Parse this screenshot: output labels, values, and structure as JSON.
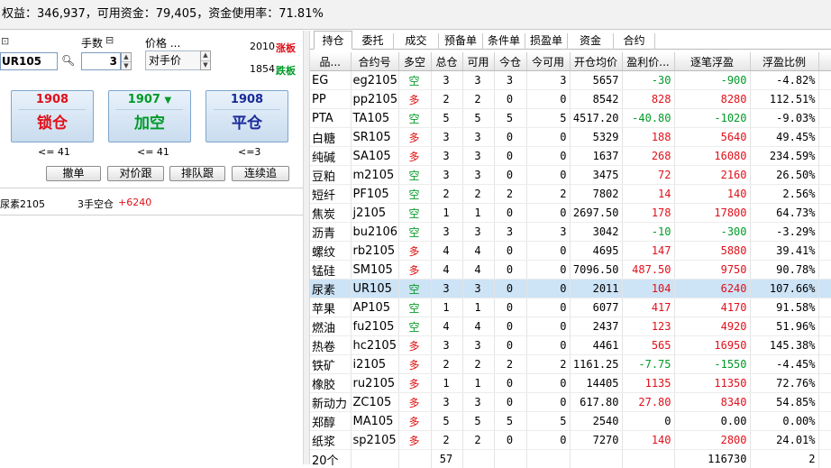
{
  "account": {
    "summary_text": "权益：346,937，可用资金：79,405，资金使用率：71.81%"
  },
  "order_panel": {
    "contract": "UR105",
    "qty_label": "手数",
    "qty_value": "3",
    "price_label": "价格 ...",
    "price_type": "对手价",
    "limit_up_price": "2010",
    "limit_up_label": "涨板",
    "limit_down_price": "1854",
    "limit_down_label": "跌板",
    "buttons": [
      {
        "price": "1908",
        "label": "锁仓",
        "limit": "<= 41",
        "color": "#e0101a"
      },
      {
        "price": "1907",
        "label": "加空",
        "limit": "<= 41",
        "color": "#009a28"
      },
      {
        "price": "1908",
        "label": "平仓",
        "limit": "<=3",
        "color": "#1a2a9a"
      }
    ],
    "small_buttons": [
      "撤单",
      "对价跟",
      "排队跟",
      "连续追"
    ],
    "position_line": {
      "name": "尿素2105",
      "desc": "3手空仓",
      "pnl": "+6240"
    }
  },
  "tabs": [
    "持仓",
    "委托",
    "成交",
    "预备单",
    "条件单",
    "损盈单",
    "资金",
    "合约"
  ],
  "active_tab": "持仓",
  "table": {
    "headers": [
      "品...",
      "合约号",
      "多空",
      "总仓",
      "可用",
      "今仓",
      "今可用",
      "开仓均价",
      "盈利价...",
      "逐笔浮盈",
      "浮盈比例"
    ],
    "rows": [
      [
        "EG",
        "eg2105",
        "空",
        "3",
        "3",
        "3",
        "3",
        "5657",
        "-30",
        "-900",
        "-4.82%"
      ],
      [
        "PP",
        "pp2105",
        "多",
        "2",
        "2",
        "0",
        "0",
        "8542",
        "828",
        "8280",
        "112.51%"
      ],
      [
        "PTA",
        "TA105",
        "空",
        "5",
        "5",
        "5",
        "5",
        "4517.20",
        "-40.80",
        "-1020",
        "-9.03%"
      ],
      [
        "白糖",
        "SR105",
        "多",
        "3",
        "3",
        "0",
        "0",
        "5329",
        "188",
        "5640",
        "49.45%"
      ],
      [
        "纯碱",
        "SA105",
        "多",
        "3",
        "3",
        "0",
        "0",
        "1637",
        "268",
        "16080",
        "234.59%"
      ],
      [
        "豆粕",
        "m2105",
        "空",
        "3",
        "3",
        "0",
        "0",
        "3475",
        "72",
        "2160",
        "26.50%"
      ],
      [
        "短纤",
        "PF105",
        "空",
        "2",
        "2",
        "2",
        "2",
        "7802",
        "14",
        "140",
        "2.56%"
      ],
      [
        "焦炭",
        "j2105",
        "空",
        "1",
        "1",
        "0",
        "0",
        "2697.50",
        "178",
        "17800",
        "64.73%"
      ],
      [
        "沥青",
        "bu2106",
        "空",
        "3",
        "3",
        "3",
        "3",
        "3042",
        "-10",
        "-300",
        "-3.29%"
      ],
      [
        "螺纹",
        "rb2105",
        "多",
        "4",
        "4",
        "0",
        "0",
        "4695",
        "147",
        "5880",
        "39.41%"
      ],
      [
        "锰硅",
        "SM105",
        "多",
        "4",
        "4",
        "0",
        "0",
        "7096.50",
        "487.50",
        "9750",
        "90.78%"
      ],
      [
        "尿素",
        "UR105",
        "空",
        "3",
        "3",
        "0",
        "0",
        "2011",
        "104",
        "6240",
        "107.66%"
      ],
      [
        "苹果",
        "AP105",
        "空",
        "1",
        "1",
        "0",
        "0",
        "6077",
        "417",
        "4170",
        "91.58%"
      ],
      [
        "燃油",
        "fu2105",
        "空",
        "4",
        "4",
        "0",
        "0",
        "2437",
        "123",
        "4920",
        "51.96%"
      ],
      [
        "热卷",
        "hc2105",
        "多",
        "3",
        "3",
        "0",
        "0",
        "4461",
        "565",
        "16950",
        "145.38%"
      ],
      [
        "铁矿",
        "i2105",
        "多",
        "2",
        "2",
        "2",
        "2",
        "1161.25",
        "-7.75",
        "-1550",
        "-4.45%"
      ],
      [
        "橡胶",
        "ru2105",
        "多",
        "1",
        "1",
        "0",
        "0",
        "14405",
        "1135",
        "11350",
        "72.76%"
      ],
      [
        "新动力",
        "ZC105",
        "多",
        "3",
        "3",
        "0",
        "0",
        "617.80",
        "27.80",
        "8340",
        "54.85%"
      ],
      [
        "郑醇",
        "MA105",
        "多",
        "5",
        "5",
        "5",
        "5",
        "2540",
        "0",
        "0.00",
        "0.00%"
      ],
      [
        "纸浆",
        "sp2105",
        "多",
        "2",
        "2",
        "0",
        "0",
        "7270",
        "140",
        "2800",
        "24.01%"
      ]
    ],
    "selected_row": 11,
    "footer": {
      "count": "20个",
      "total_pos": "57",
      "total_pnl": "116730",
      "edge": "2"
    }
  },
  "colors": {
    "profit": "#e0101a",
    "loss": "#009a28",
    "selected": "#cde3f6"
  }
}
